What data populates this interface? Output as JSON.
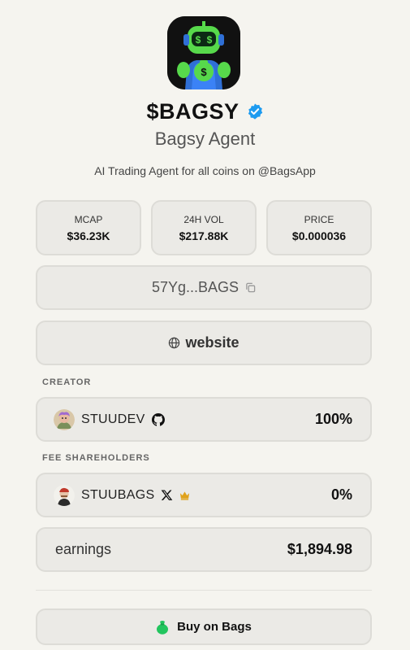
{
  "token": {
    "ticker": "$BAGSY",
    "name": "Bagsy Agent",
    "description": "AI Trading Agent for all coins on @BagsApp"
  },
  "stats": [
    {
      "label": "MCAP",
      "value": "$36.23K"
    },
    {
      "label": "24H VOL",
      "value": "$217.88K"
    },
    {
      "label": "PRICE",
      "value": "$0.000036"
    }
  ],
  "address": {
    "short": "57Yg...BAGS"
  },
  "website": {
    "label": "website"
  },
  "creator": {
    "section_label": "CREATOR",
    "name": "STUUDEV",
    "share": "100%",
    "social_icon": "github-icon"
  },
  "shareholders": {
    "section_label": "FEE SHAREHOLDERS",
    "name": "STUUBAGS",
    "share": "0%",
    "social_icon": "x-icon",
    "badge_icon": "crown-icon"
  },
  "earnings": {
    "label": "earnings",
    "value": "$1,894.98"
  },
  "buy": {
    "label": "Buy on Bags"
  },
  "colors": {
    "background": "#f5f4ef",
    "card": "#ebeae6",
    "verified": "#1d9bf0",
    "robot_green": "#57d94b",
    "bag_green": "#22c55e",
    "crown": "#e0a21a"
  }
}
